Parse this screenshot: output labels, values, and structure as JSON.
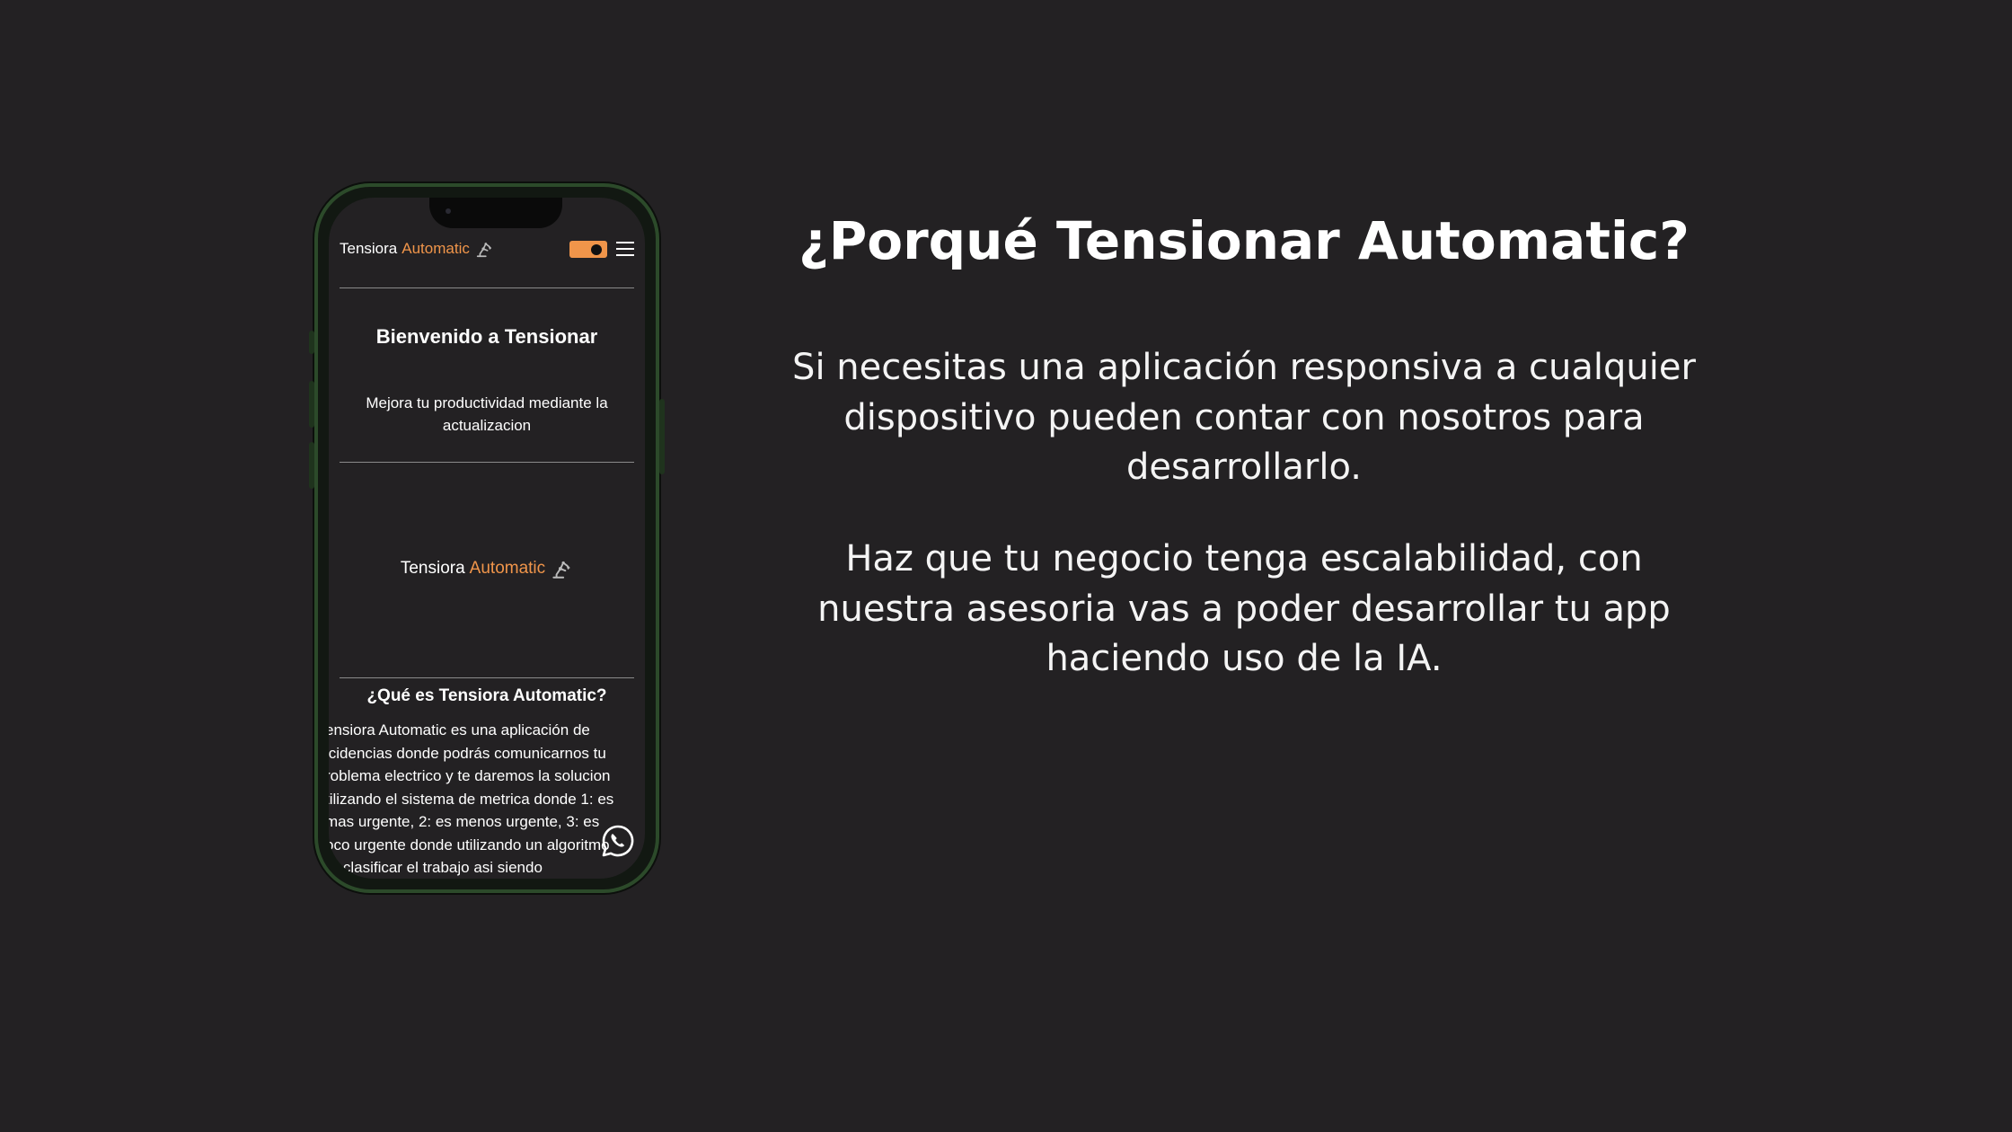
{
  "phone": {
    "header": {
      "brand_primary": "Tensiora",
      "brand_accent": "Automatic",
      "icon": "robot-arm-icon",
      "toggle_icon": "theme-toggle-icon",
      "menu_icon": "hamburger-menu-icon"
    },
    "welcome": {
      "title": "Bienvenido a Tensionar",
      "subtitle": "Mejora tu productividad mediante la actualizacion"
    },
    "mid_brand": {
      "brand_primary": "Tensiora",
      "brand_accent": "Automatic"
    },
    "about": {
      "title": "¿Qué es Tensiora Automatic?",
      "lines": [
        "ensiora Automatic es una aplicación de",
        "icidencias donde podrás comunicarnos tu",
        "roblema electrico y te daremos la solucion",
        "tilizando el sistema de metrica donde 1: es",
        " mas urgente, 2: es menos urgente, 3: es",
        "oco urgente donde utilizando un algoritmo",
        "ra clasificar el trabajo asi siendo"
      ]
    },
    "floating_icon": "whatsapp-icon"
  },
  "slide": {
    "title": "¿Porqué Tensionar Automatic?",
    "paragraph1_lines": [
      "Si necesitas una aplicación responsiva a cualquier",
      "dispositivo pueden contar con nosotros para",
      "desarrollarlo."
    ],
    "paragraph2_lines": [
      "Haz que tu negocio tenga escalabilidad, con",
      "nuestra asesoria vas a poder desarrollar tu app",
      "haciendo uso de la IA."
    ]
  },
  "colors": {
    "background": "#232123",
    "accent": "#f0954a",
    "phone_frame": "#2c4a2a"
  }
}
